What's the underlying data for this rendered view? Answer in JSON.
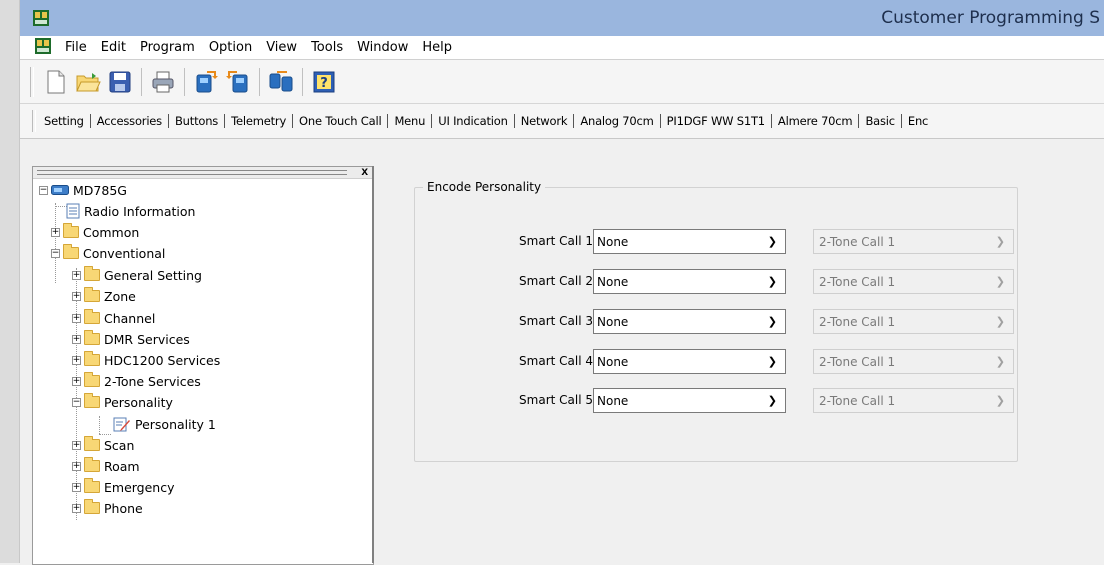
{
  "window": {
    "title": "Customer Programming S"
  },
  "menu": {
    "items": [
      "File",
      "Edit",
      "Program",
      "Option",
      "View",
      "Tools",
      "Window",
      "Help"
    ]
  },
  "toolbar": {
    "buttons": [
      "new-icon",
      "open-icon",
      "save-icon",
      "print-icon",
      "read-radio-icon",
      "write-radio-icon",
      "clone-icon",
      "help-icon"
    ]
  },
  "tabs": [
    "Setting",
    "Accessories",
    "Buttons",
    "Telemetry",
    "One Touch Call",
    "Menu",
    "UI Indication",
    "Network",
    "Analog 70cm",
    "PI1DGF WW S1T1",
    "Almere 70cm",
    "Basic",
    "Enc"
  ],
  "tree": {
    "close_label": "x",
    "nodes": [
      {
        "label": "MD785G"
      },
      {
        "label": "Radio Information"
      },
      {
        "label": "Common"
      },
      {
        "label": "Conventional"
      },
      {
        "label": "General Setting"
      },
      {
        "label": "Zone"
      },
      {
        "label": "Channel"
      },
      {
        "label": "DMR Services"
      },
      {
        "label": "HDC1200 Services"
      },
      {
        "label": "2-Tone Services"
      },
      {
        "label": "Personality"
      },
      {
        "label": "Personality 1"
      },
      {
        "label": "Scan"
      },
      {
        "label": "Roam"
      },
      {
        "label": "Emergency"
      },
      {
        "label": "Phone"
      }
    ]
  },
  "panel": {
    "group_title": "Encode Personality",
    "rows": [
      {
        "label": "Smart Call 1",
        "value": "None",
        "secondary": "2-Tone Call 1"
      },
      {
        "label": "Smart Call 2",
        "value": "None",
        "secondary": "2-Tone Call 1"
      },
      {
        "label": "Smart Call 3",
        "value": "None",
        "secondary": "2-Tone Call 1"
      },
      {
        "label": "Smart Call 4",
        "value": "None",
        "secondary": "2-Tone Call 1"
      },
      {
        "label": "Smart Call 5",
        "value": "None",
        "secondary": "2-Tone Call 1"
      }
    ]
  },
  "colors": {
    "titlebar": "#9ab6de",
    "folder": "#f8d775"
  }
}
